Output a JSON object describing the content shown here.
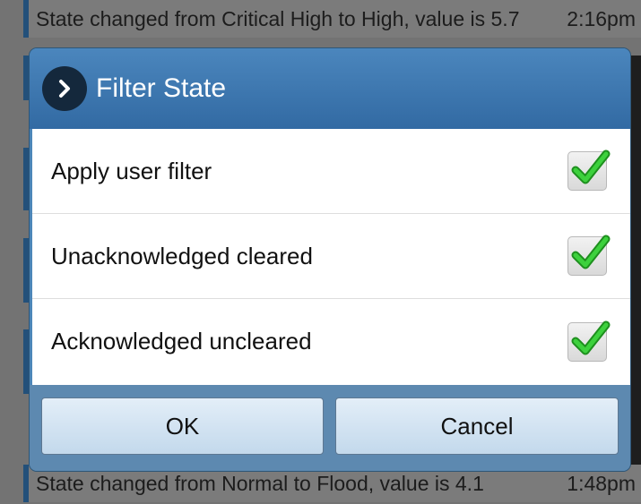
{
  "background_list": {
    "rows": [
      {
        "message": "State changed from Critical High to High, value is 5.7",
        "time": "2:16pm"
      },
      {
        "message": "State changed from Normal to Flood, value is 4.1",
        "time": "1:48pm"
      }
    ]
  },
  "dialog": {
    "title": "Filter State",
    "header_icon": "chevron-right-icon",
    "options": [
      {
        "label": "Apply user filter",
        "checked": true
      },
      {
        "label": "Unacknowledged cleared",
        "checked": true
      },
      {
        "label": "Acknowledged uncleared",
        "checked": true
      }
    ],
    "ok_label": "OK",
    "cancel_label": "Cancel"
  },
  "colors": {
    "header": "#326aa3",
    "check": "#2fc22f",
    "row_accent": "#23507a"
  }
}
